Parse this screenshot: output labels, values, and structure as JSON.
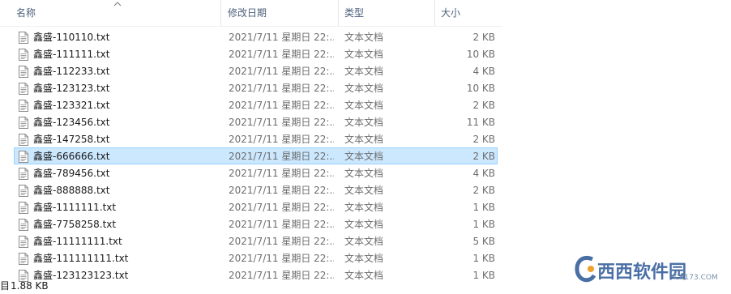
{
  "columns": {
    "name": "名称",
    "date": "修改日期",
    "type": "类型",
    "size": "大小"
  },
  "files": [
    {
      "name": "鑫盛-110110.txt",
      "date": "2021/7/11 星期日 22:...",
      "type": "文本文档",
      "size": "2 KB"
    },
    {
      "name": "鑫盛-111111.txt",
      "date": "2021/7/11 星期日 22:...",
      "type": "文本文档",
      "size": "10 KB"
    },
    {
      "name": "鑫盛-112233.txt",
      "date": "2021/7/11 星期日 22:...",
      "type": "文本文档",
      "size": "4 KB"
    },
    {
      "name": "鑫盛-123123.txt",
      "date": "2021/7/11 星期日 22:...",
      "type": "文本文档",
      "size": "10 KB"
    },
    {
      "name": "鑫盛-123321.txt",
      "date": "2021/7/11 星期日 22:...",
      "type": "文本文档",
      "size": "2 KB"
    },
    {
      "name": "鑫盛-123456.txt",
      "date": "2021/7/11 星期日 22:...",
      "type": "文本文档",
      "size": "11 KB"
    },
    {
      "name": "鑫盛-147258.txt",
      "date": "2021/7/11 星期日 22:...",
      "type": "文本文档",
      "size": "2 KB"
    },
    {
      "name": "鑫盛-666666.txt",
      "date": "2021/7/11 星期日 22:...",
      "type": "文本文档",
      "size": "2 KB",
      "selected": true
    },
    {
      "name": "鑫盛-789456.txt",
      "date": "2021/7/11 星期日 22:...",
      "type": "文本文档",
      "size": "4 KB"
    },
    {
      "name": "鑫盛-888888.txt",
      "date": "2021/7/11 星期日 22:...",
      "type": "文本文档",
      "size": "2 KB"
    },
    {
      "name": "鑫盛-1111111.txt",
      "date": "2021/7/11 星期日 22:...",
      "type": "文本文档",
      "size": "1 KB"
    },
    {
      "name": "鑫盛-7758258.txt",
      "date": "2021/7/11 星期日 22:...",
      "type": "文本文档",
      "size": "1 KB"
    },
    {
      "name": "鑫盛-11111111.txt",
      "date": "2021/7/11 星期日 22:...",
      "type": "文本文档",
      "size": "5 KB"
    },
    {
      "name": "鑫盛-111111111.txt",
      "date": "2021/7/11 星期日 22:...",
      "type": "文本文档",
      "size": "1 KB"
    },
    {
      "name": "鑫盛-123123123.txt",
      "date": "2021/7/11 星期日 22:...",
      "type": "文本文档",
      "size": "1 KB"
    }
  ],
  "status": {
    "selected_char": "目",
    "selected_size": "1.88 KB"
  },
  "watermark": {
    "main": "西西软件园",
    "sub": "CR173.COM"
  },
  "colors": {
    "selection_bg": "#cce8ff",
    "selection_border": "#99d1ff",
    "header_text": "#4c607a"
  }
}
